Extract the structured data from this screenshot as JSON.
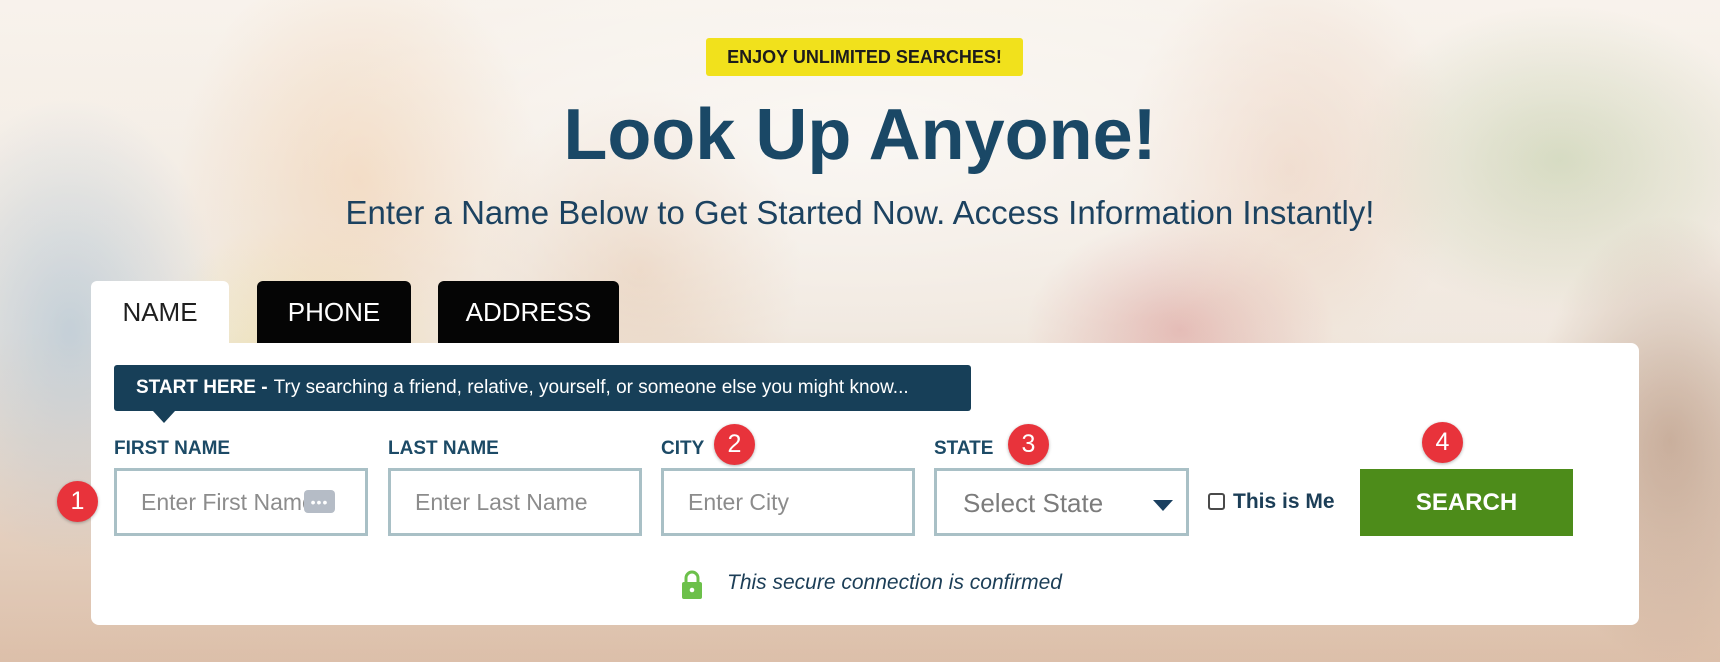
{
  "promo": {
    "badge": "ENJOY UNLIMITED SEARCHES!"
  },
  "hero": {
    "title": "Look Up Anyone!",
    "subtitle": "Enter a Name Below to Get Started Now. Access Information Instantly!"
  },
  "tabs": [
    {
      "label": "NAME",
      "active": true
    },
    {
      "label": "PHONE",
      "active": false
    },
    {
      "label": "ADDRESS",
      "active": false
    }
  ],
  "tip": {
    "bold": "START HERE -",
    "text": "Try searching a friend, relative, yourself, or someone else you might know..."
  },
  "form": {
    "first_name": {
      "label": "FIRST NAME",
      "placeholder": "Enter First Name",
      "value": ""
    },
    "last_name": {
      "label": "LAST NAME",
      "placeholder": "Enter Last Name",
      "value": ""
    },
    "city": {
      "label": "CITY",
      "placeholder": "Enter City",
      "value": ""
    },
    "state": {
      "label": "STATE",
      "selected": "Select State"
    },
    "this_is_me": {
      "label": "This is Me",
      "checked": false
    },
    "search_label": "SEARCH"
  },
  "markers": [
    "1",
    "2",
    "3",
    "4"
  ],
  "secure": {
    "text": "This secure connection is confirmed",
    "icon": "lock-icon"
  },
  "icons": {
    "keypad": "•••",
    "keypad_name": "password-manager-icon",
    "state_caret": "chevron-down-icon"
  },
  "colors": {
    "badge": "#f1e11c",
    "headline": "#1a4866",
    "tip_background": "#173f58",
    "search_button": "#4d8c1a",
    "marker": "#e8333b",
    "field_border": "#a9c0c6",
    "lock": "#6cc04a"
  }
}
